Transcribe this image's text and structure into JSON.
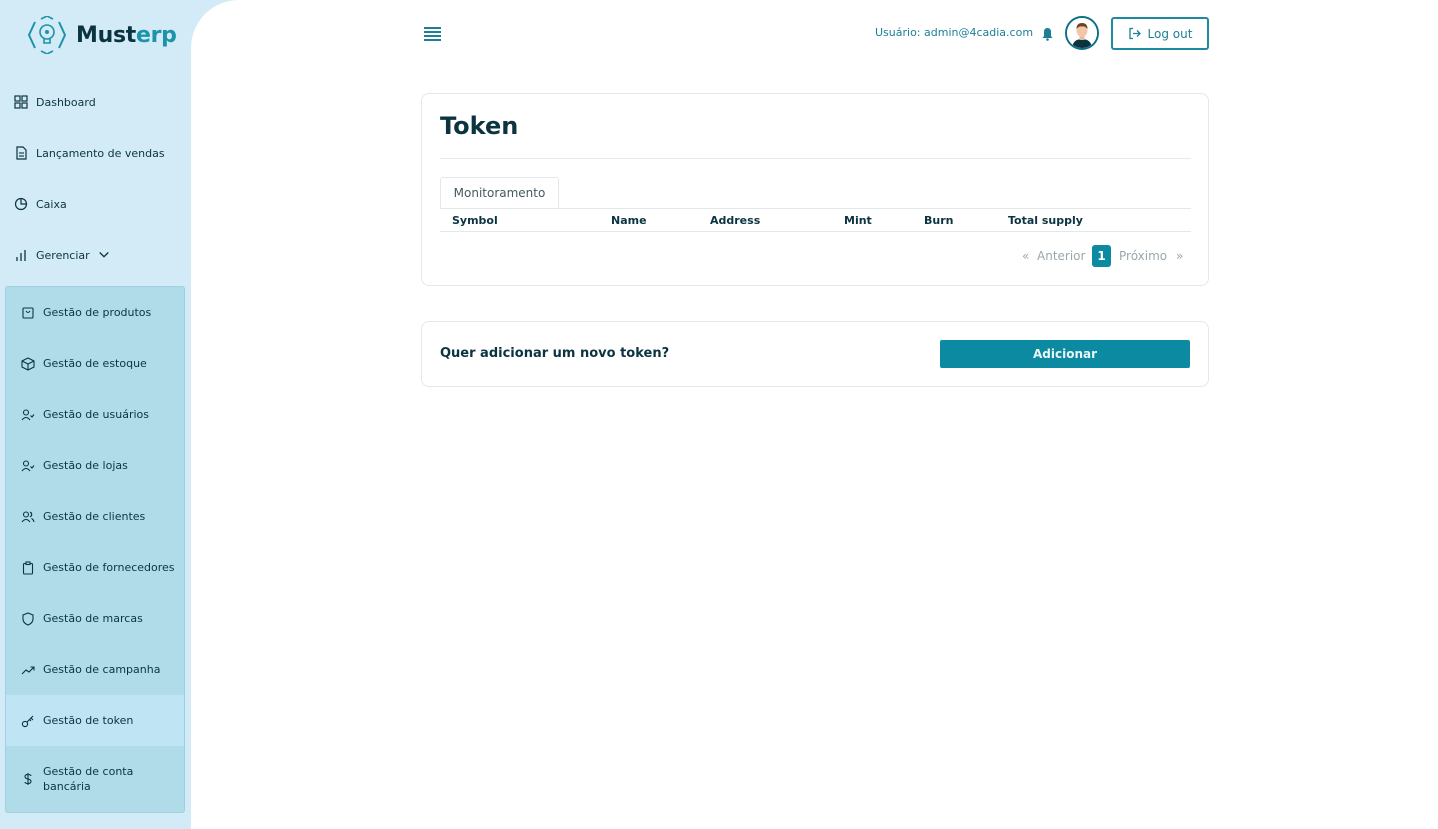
{
  "brand": {
    "name_part1": "Must",
    "name_part2": "erp"
  },
  "sidebar": {
    "items": [
      {
        "label": "Dashboard",
        "icon": "grid-icon"
      },
      {
        "label": "Lançamento de vendas",
        "icon": "document-icon"
      },
      {
        "label": "Caixa",
        "icon": "pie-chart-icon"
      },
      {
        "label": "Gerenciar",
        "icon": "bar-chart-icon",
        "expanded": true
      }
    ],
    "submenu": [
      {
        "label": "Gestão de produtos",
        "icon": "shopping-bag-icon"
      },
      {
        "label": "Gestão de estoque",
        "icon": "box-icon"
      },
      {
        "label": "Gestão de usuários",
        "icon": "user-check-icon"
      },
      {
        "label": "Gestão de lojas",
        "icon": "user-check-icon"
      },
      {
        "label": "Gestão de clientes",
        "icon": "users-icon"
      },
      {
        "label": "Gestão de fornecedores",
        "icon": "clipboard-icon"
      },
      {
        "label": "Gestão de marcas",
        "icon": "shield-icon"
      },
      {
        "label": "Gestão de campanha",
        "icon": "trending-up-icon"
      },
      {
        "label": "Gestão de token",
        "icon": "key-icon",
        "active": true
      },
      {
        "label_line1": "Gestão de conta",
        "label_line2": "bancária",
        "icon": "dollar-icon"
      }
    ]
  },
  "header": {
    "user_label": "Usuário: admin@4cadia.com",
    "logout_label": "Log out"
  },
  "token_card": {
    "title": "Token",
    "tab_label": "Monitoramento",
    "columns": [
      "Symbol",
      "Name",
      "Address",
      "Mint",
      "Burn",
      "Total supply"
    ],
    "rows": [],
    "pagination": {
      "prev_arrow": "«",
      "prev_label": "Anterior",
      "current_page": "1",
      "next_label": "Próximo",
      "next_arrow": "»"
    }
  },
  "add_card": {
    "question": "Quer adicionar um novo token?",
    "button_label": "Adicionar"
  },
  "colors": {
    "accent": "#0b8aa1",
    "sidebar_bg": "#d2ebf7",
    "submenu_bg": "#b0dce9",
    "text_dark": "#0b3440"
  }
}
